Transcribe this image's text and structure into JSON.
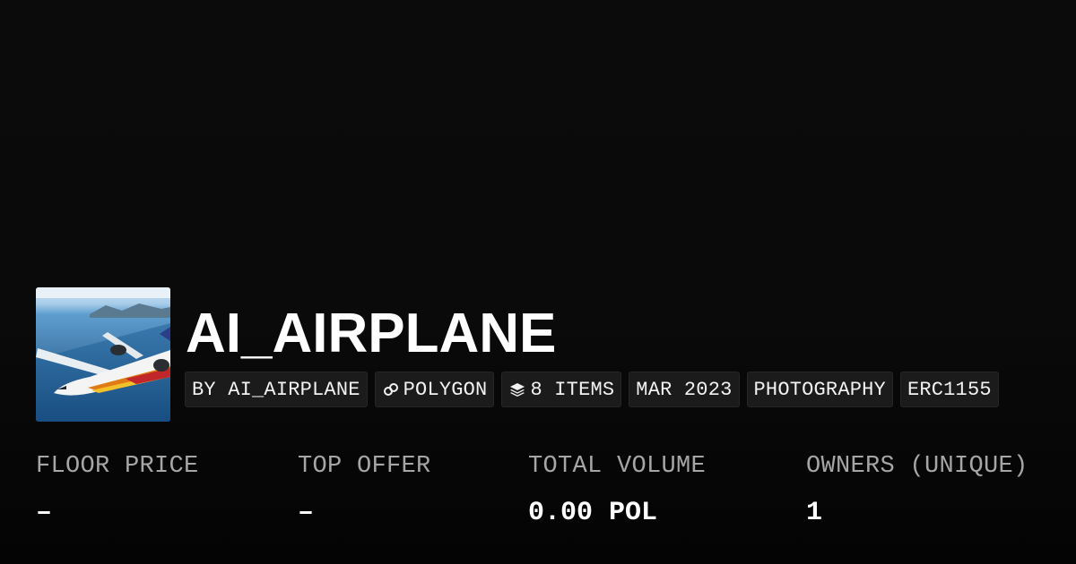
{
  "collection": {
    "title": "AI_AIRPLANE",
    "avatar_icon": "airplane-photo"
  },
  "tags": [
    {
      "label": "BY AI_AIRPLANE"
    },
    {
      "label": "POLYGON",
      "icon": "polygon-link-icon"
    },
    {
      "label": "8 ITEMS",
      "icon": "layers-icon"
    },
    {
      "label": "MAR 2023"
    },
    {
      "label": "PHOTOGRAPHY"
    },
    {
      "label": "ERC1155"
    }
  ],
  "stats": [
    {
      "label": "FLOOR PRICE",
      "value": "–"
    },
    {
      "label": "TOP OFFER",
      "value": "–"
    },
    {
      "label": "TOTAL VOLUME",
      "value": "0.00 POL"
    },
    {
      "label": "OWNERS (UNIQUE)",
      "value": "1"
    }
  ],
  "colors": {
    "background": "#0b0b0b",
    "tag_background": "#1b1b1b",
    "label_gray": "#a6a6a6",
    "text": "#ffffff"
  }
}
